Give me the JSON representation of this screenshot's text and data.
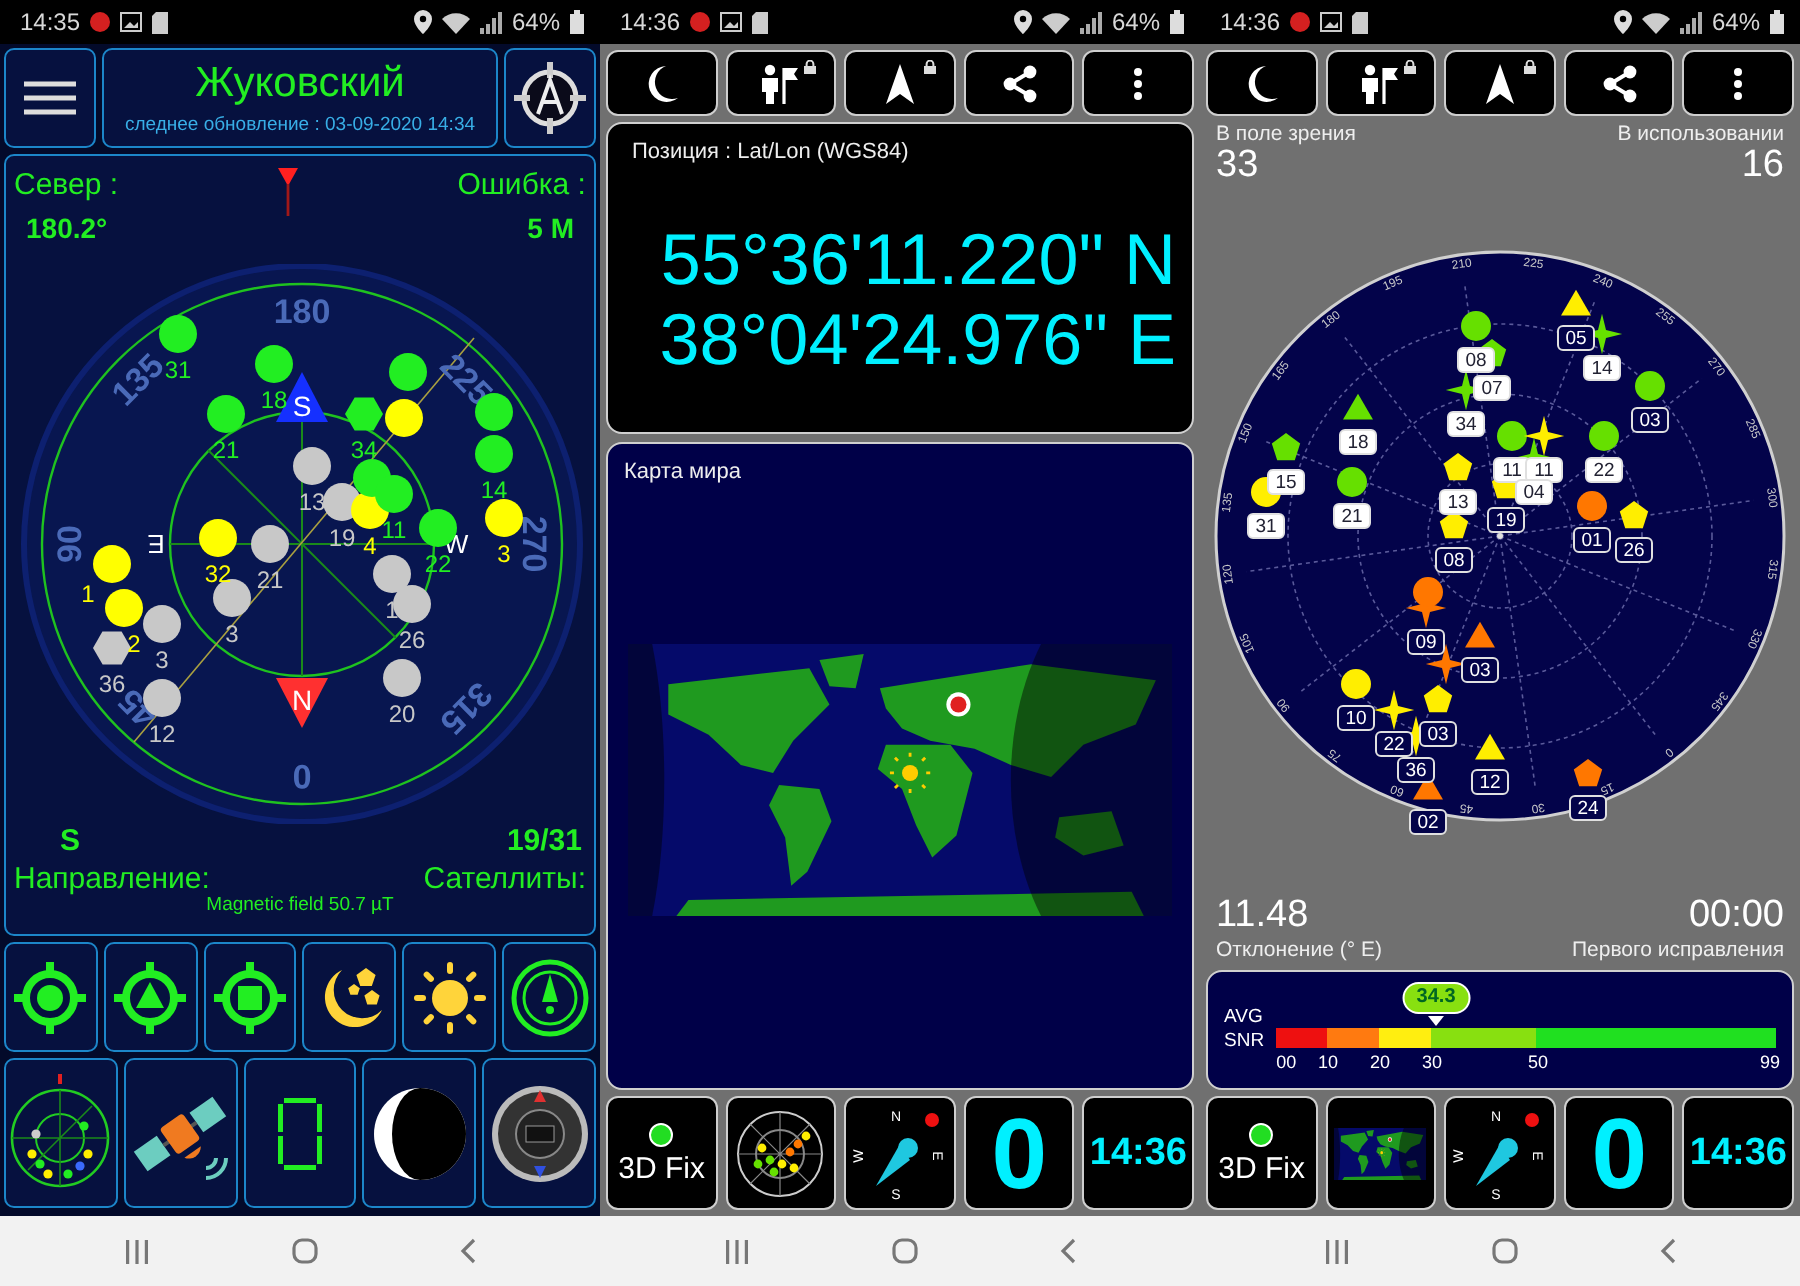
{
  "compass_screen": {
    "status_bar": {
      "time": "14:35",
      "battery": "64%"
    },
    "header": {
      "title": "Жуковский",
      "subtitle": "следнее обновление : 03-09-2020 14:34"
    },
    "readouts": [
      {
        "label": "Север :",
        "value": "180.2°"
      },
      {
        "label": "Ошибка :",
        "value": "5 M"
      }
    ],
    "radar": {
      "ring_labels": [
        "180",
        "225",
        "270",
        "315",
        "0",
        "45",
        "90",
        "135"
      ],
      "cardinals": [
        {
          "letter": "S",
          "kind": "pointer",
          "color": "#1530ff"
        },
        {
          "letter": "N",
          "kind": "pointer",
          "color": "#ff3030"
        },
        {
          "letter": "E",
          "kind": "rotated"
        },
        {
          "letter": "W",
          "kind": "plain"
        }
      ],
      "satellites": [
        {
          "label": "31",
          "color": "#22ee22",
          "kind": "circle"
        },
        {
          "label": "18",
          "color": "#22ee22",
          "kind": "circle"
        },
        {
          "label": "21",
          "color": "#22ee22",
          "kind": "circle"
        },
        {
          "label": "34",
          "color": "#22ee22",
          "kind": "hexagon"
        },
        {
          "color": "#22ee22",
          "kind": "circle"
        },
        {
          "color": "#ffff00",
          "kind": "circle"
        },
        {
          "color": "#22ee22",
          "kind": "circle"
        },
        {
          "label": "14",
          "color": "#22ee22",
          "kind": "circle"
        },
        {
          "label": "3",
          "color": "#ffff00",
          "kind": "circle"
        },
        {
          "label": "13",
          "color": "#c8c8c8",
          "kind": "circle"
        },
        {
          "label": "19",
          "color": "#c8c8c8",
          "kind": "circle"
        },
        {
          "label": "4",
          "color": "#ffff00",
          "kind": "circle"
        },
        {
          "color": "#22ee22",
          "kind": "circle"
        },
        {
          "label": "11",
          "color": "#22ee22",
          "kind": "circle"
        },
        {
          "label": "22",
          "color": "#22ee22",
          "kind": "circle"
        },
        {
          "label": "32",
          "color": "#ffff00",
          "kind": "circle"
        },
        {
          "label": "21",
          "color": "#c8c8c8",
          "kind": "circle"
        },
        {
          "label": "3",
          "color": "#c8c8c8",
          "kind": "circle"
        },
        {
          "label": "1",
          "color": "#ffff00",
          "kind": "circle"
        },
        {
          "label": "2",
          "color": "#ffff00",
          "kind": "circle"
        },
        {
          "label": "3",
          "color": "#c8c8c8",
          "kind": "circle"
        },
        {
          "label": "36",
          "color": "#c8c8c8",
          "kind": "hexagon"
        },
        {
          "label": "12",
          "color": "#c8c8c8",
          "kind": "circle"
        },
        {
          "label": "1",
          "color": "#c8c8c8",
          "kind": "circle"
        },
        {
          "label": "26",
          "color": "#c8c8c8",
          "kind": "circle"
        },
        {
          "label": "20",
          "color": "#c8c8c8",
          "kind": "circle"
        }
      ]
    },
    "summary": [
      {
        "label": "Направление:",
        "value": "S"
      },
      {
        "label": "Сателлиты:",
        "value": "19/31"
      }
    ],
    "magnetic_field": "Magnetic field 50.7 µT"
  },
  "position_screen": {
    "status_bar": {
      "time": "14:36",
      "battery": "64%"
    },
    "toolbar": [
      {
        "kind": "moon",
        "locked": false
      },
      {
        "kind": "hiker",
        "locked": true
      },
      {
        "kind": "navigation",
        "locked": true
      },
      {
        "kind": "share",
        "locked": false
      },
      {
        "kind": "more",
        "locked": false
      }
    ],
    "position": {
      "title": "Позиция : Lat/Lon (WGS84)",
      "latitude": "55°36'11.220\" N",
      "longitude": "38°04'24.976\" E"
    },
    "world_map": {
      "title": "Карта мира"
    },
    "tiles": [
      {
        "kind": "fix",
        "label": "3D Fix"
      },
      {
        "kind": "skyplot"
      },
      {
        "kind": "compass",
        "letters": [
          "N",
          "E",
          "S",
          "W"
        ]
      },
      {
        "kind": "count",
        "value": "0"
      },
      {
        "kind": "clock",
        "value": "14:36"
      }
    ]
  },
  "skyplot_screen": {
    "status_bar": {
      "time": "14:36",
      "battery": "64%"
    },
    "toolbar": [
      {
        "kind": "moon",
        "locked": false
      },
      {
        "kind": "hiker",
        "locked": true
      },
      {
        "kind": "navigation",
        "locked": true
      },
      {
        "kind": "share",
        "locked": false
      },
      {
        "kind": "more",
        "locked": false
      }
    ],
    "in_view": {
      "label": "В поле зрения",
      "value": "33"
    },
    "in_use": {
      "label": "В использовании",
      "value": "16"
    },
    "skyplot": {
      "ring_labels": [
        "0",
        "15",
        "30",
        "45",
        "60",
        "75",
        "90",
        "105",
        "120",
        "135",
        "150",
        "165",
        "180",
        "195",
        "210",
        "225",
        "240",
        "255",
        "270",
        "285",
        "300",
        "315",
        "330",
        "345"
      ],
      "satellites": [
        {
          "label": "05",
          "color": "#ffee00",
          "kind": "triangle",
          "used": false
        },
        {
          "label": "14",
          "color": "#66e000",
          "kind": "star",
          "used": true
        },
        {
          "label": "08",
          "color": "#66e000",
          "kind": "circle",
          "used": true
        },
        {
          "label": "07",
          "color": "#66e000",
          "kind": "pentagon",
          "used": true
        },
        {
          "label": "34",
          "color": "#66e000",
          "kind": "star",
          "used": true
        },
        {
          "label": "03",
          "color": "#66e000",
          "kind": "circle",
          "used": false
        },
        {
          "label": "18",
          "color": "#66e000",
          "kind": "triangle",
          "used": true
        },
        {
          "label": "15",
          "color": "#66e000",
          "kind": "pentagon",
          "used": true
        },
        {
          "label": "21",
          "color": "#66e000",
          "kind": "circle",
          "used": true
        },
        {
          "label": "31",
          "color": "#ffee00",
          "kind": "circle",
          "used": true
        },
        {
          "label": "11",
          "color": "#66e000",
          "kind": "circle",
          "used": true
        },
        {
          "label": "11",
          "color": "#ffee00",
          "kind": "star",
          "used": true
        },
        {
          "label": "22",
          "color": "#66e000",
          "kind": "circle",
          "used": true
        },
        {
          "label": "13",
          "color": "#ffee00",
          "kind": "pentagon",
          "used": true
        },
        {
          "label": "04",
          "color": "#66e000",
          "kind": "star",
          "used": true
        },
        {
          "label": "19",
          "color": "#ffee00",
          "kind": "pentagon",
          "used": false
        },
        {
          "label": "08",
          "color": "#ffee00",
          "kind": "pentagon",
          "used": false
        },
        {
          "label": "01",
          "color": "#ff7700",
          "kind": "circle",
          "used": false
        },
        {
          "label": "26",
          "color": "#ffee00",
          "kind": "pentagon",
          "used": false
        },
        {
          "label": "09",
          "color": "#ff7700",
          "kind": "star",
          "used": false
        },
        {
          "color": "#ff7700",
          "kind": "circle"
        },
        {
          "label": "03",
          "color": "#ff7700",
          "kind": "triangle",
          "used": false
        },
        {
          "color": "#ff7700",
          "kind": "star"
        },
        {
          "label": "10",
          "color": "#ffee00",
          "kind": "circle",
          "used": false
        },
        {
          "label": "22",
          "color": "#ffee00",
          "kind": "star",
          "used": false
        },
        {
          "label": "03",
          "color": "#ffee00",
          "kind": "pentagon",
          "used": false
        },
        {
          "label": "36",
          "color": "#ffee00",
          "kind": "star",
          "used": false
        },
        {
          "label": "12",
          "color": "#ffee00",
          "kind": "triangle",
          "used": false
        },
        {
          "label": "02",
          "color": "#ff7700",
          "kind": "triangle",
          "used": false
        },
        {
          "label": "24",
          "color": "#ff7700",
          "kind": "pentagon",
          "used": false
        }
      ]
    },
    "declination": {
      "value": "11.48",
      "label": "Отклонение (° E)"
    },
    "first_fix": {
      "value": "00:00",
      "label": "Первого исправления"
    },
    "snr": {
      "labels": [
        "AVG",
        "SNR"
      ],
      "average": "34.3",
      "level": 0.32,
      "ticks": [
        "00",
        "10",
        "20",
        "30",
        "50",
        "99"
      ]
    },
    "tiles": [
      {
        "kind": "fix",
        "label": "3D Fix"
      },
      {
        "kind": "map"
      },
      {
        "kind": "compass",
        "letters": [
          "N",
          "E",
          "S",
          "W"
        ]
      },
      {
        "kind": "count",
        "value": "0"
      },
      {
        "kind": "clock",
        "value": "14:36"
      }
    ]
  }
}
